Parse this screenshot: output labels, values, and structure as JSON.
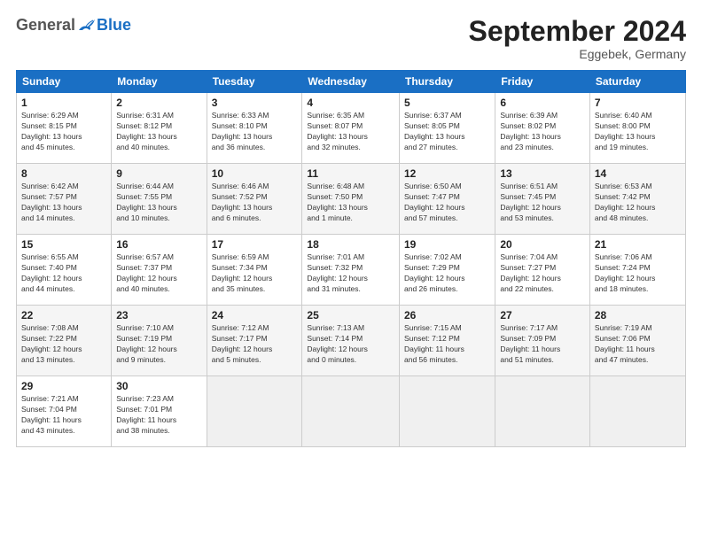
{
  "logo": {
    "general": "General",
    "blue": "Blue"
  },
  "title": "September 2024",
  "subtitle": "Eggebek, Germany",
  "days_header": [
    "Sunday",
    "Monday",
    "Tuesday",
    "Wednesday",
    "Thursday",
    "Friday",
    "Saturday"
  ],
  "weeks": [
    [
      {
        "day": "1",
        "info": "Sunrise: 6:29 AM\nSunset: 8:15 PM\nDaylight: 13 hours\nand 45 minutes."
      },
      {
        "day": "2",
        "info": "Sunrise: 6:31 AM\nSunset: 8:12 PM\nDaylight: 13 hours\nand 40 minutes."
      },
      {
        "day": "3",
        "info": "Sunrise: 6:33 AM\nSunset: 8:10 PM\nDaylight: 13 hours\nand 36 minutes."
      },
      {
        "day": "4",
        "info": "Sunrise: 6:35 AM\nSunset: 8:07 PM\nDaylight: 13 hours\nand 32 minutes."
      },
      {
        "day": "5",
        "info": "Sunrise: 6:37 AM\nSunset: 8:05 PM\nDaylight: 13 hours\nand 27 minutes."
      },
      {
        "day": "6",
        "info": "Sunrise: 6:39 AM\nSunset: 8:02 PM\nDaylight: 13 hours\nand 23 minutes."
      },
      {
        "day": "7",
        "info": "Sunrise: 6:40 AM\nSunset: 8:00 PM\nDaylight: 13 hours\nand 19 minutes."
      }
    ],
    [
      {
        "day": "8",
        "info": "Sunrise: 6:42 AM\nSunset: 7:57 PM\nDaylight: 13 hours\nand 14 minutes."
      },
      {
        "day": "9",
        "info": "Sunrise: 6:44 AM\nSunset: 7:55 PM\nDaylight: 13 hours\nand 10 minutes."
      },
      {
        "day": "10",
        "info": "Sunrise: 6:46 AM\nSunset: 7:52 PM\nDaylight: 13 hours\nand 6 minutes."
      },
      {
        "day": "11",
        "info": "Sunrise: 6:48 AM\nSunset: 7:50 PM\nDaylight: 13 hours\nand 1 minute."
      },
      {
        "day": "12",
        "info": "Sunrise: 6:50 AM\nSunset: 7:47 PM\nDaylight: 12 hours\nand 57 minutes."
      },
      {
        "day": "13",
        "info": "Sunrise: 6:51 AM\nSunset: 7:45 PM\nDaylight: 12 hours\nand 53 minutes."
      },
      {
        "day": "14",
        "info": "Sunrise: 6:53 AM\nSunset: 7:42 PM\nDaylight: 12 hours\nand 48 minutes."
      }
    ],
    [
      {
        "day": "15",
        "info": "Sunrise: 6:55 AM\nSunset: 7:40 PM\nDaylight: 12 hours\nand 44 minutes."
      },
      {
        "day": "16",
        "info": "Sunrise: 6:57 AM\nSunset: 7:37 PM\nDaylight: 12 hours\nand 40 minutes."
      },
      {
        "day": "17",
        "info": "Sunrise: 6:59 AM\nSunset: 7:34 PM\nDaylight: 12 hours\nand 35 minutes."
      },
      {
        "day": "18",
        "info": "Sunrise: 7:01 AM\nSunset: 7:32 PM\nDaylight: 12 hours\nand 31 minutes."
      },
      {
        "day": "19",
        "info": "Sunrise: 7:02 AM\nSunset: 7:29 PM\nDaylight: 12 hours\nand 26 minutes."
      },
      {
        "day": "20",
        "info": "Sunrise: 7:04 AM\nSunset: 7:27 PM\nDaylight: 12 hours\nand 22 minutes."
      },
      {
        "day": "21",
        "info": "Sunrise: 7:06 AM\nSunset: 7:24 PM\nDaylight: 12 hours\nand 18 minutes."
      }
    ],
    [
      {
        "day": "22",
        "info": "Sunrise: 7:08 AM\nSunset: 7:22 PM\nDaylight: 12 hours\nand 13 minutes."
      },
      {
        "day": "23",
        "info": "Sunrise: 7:10 AM\nSunset: 7:19 PM\nDaylight: 12 hours\nand 9 minutes."
      },
      {
        "day": "24",
        "info": "Sunrise: 7:12 AM\nSunset: 7:17 PM\nDaylight: 12 hours\nand 5 minutes."
      },
      {
        "day": "25",
        "info": "Sunrise: 7:13 AM\nSunset: 7:14 PM\nDaylight: 12 hours\nand 0 minutes."
      },
      {
        "day": "26",
        "info": "Sunrise: 7:15 AM\nSunset: 7:12 PM\nDaylight: 11 hours\nand 56 minutes."
      },
      {
        "day": "27",
        "info": "Sunrise: 7:17 AM\nSunset: 7:09 PM\nDaylight: 11 hours\nand 51 minutes."
      },
      {
        "day": "28",
        "info": "Sunrise: 7:19 AM\nSunset: 7:06 PM\nDaylight: 11 hours\nand 47 minutes."
      }
    ],
    [
      {
        "day": "29",
        "info": "Sunrise: 7:21 AM\nSunset: 7:04 PM\nDaylight: 11 hours\nand 43 minutes."
      },
      {
        "day": "30",
        "info": "Sunrise: 7:23 AM\nSunset: 7:01 PM\nDaylight: 11 hours\nand 38 minutes."
      },
      {
        "day": "",
        "info": ""
      },
      {
        "day": "",
        "info": ""
      },
      {
        "day": "",
        "info": ""
      },
      {
        "day": "",
        "info": ""
      },
      {
        "day": "",
        "info": ""
      }
    ]
  ]
}
